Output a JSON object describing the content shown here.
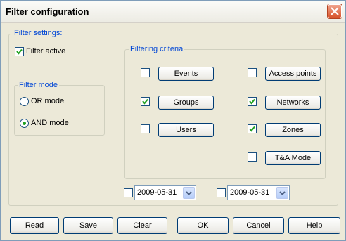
{
  "window": {
    "title": "Filter configuration"
  },
  "filter_settings": {
    "legend": "Filter settings:",
    "filter_active": {
      "label": "Filter active",
      "checked": true
    }
  },
  "filter_mode": {
    "legend": "Filter mode",
    "options": [
      {
        "label": "OR mode",
        "selected": false
      },
      {
        "label": "AND mode",
        "selected": true
      }
    ]
  },
  "criteria": {
    "legend": "Filtering criteria",
    "items": [
      {
        "label": "Events",
        "checked": false
      },
      {
        "label": "Groups",
        "checked": true
      },
      {
        "label": "Users",
        "checked": false
      },
      {
        "label": "Access points",
        "checked": false
      },
      {
        "label": "Networks",
        "checked": true
      },
      {
        "label": "Zones",
        "checked": true
      },
      {
        "label": "T&A Mode",
        "checked": false
      }
    ]
  },
  "dates": [
    {
      "value": "2009-05-31",
      "checked": false
    },
    {
      "value": "2009-05-31",
      "checked": false
    }
  ],
  "buttons": {
    "read": "Read",
    "save": "Save",
    "clear": "Clear",
    "ok": "OK",
    "cancel": "Cancel",
    "help": "Help"
  },
  "colors": {
    "group_label": "#0046d5",
    "check_mark": "#21a121",
    "close_button": "#d8552d"
  }
}
